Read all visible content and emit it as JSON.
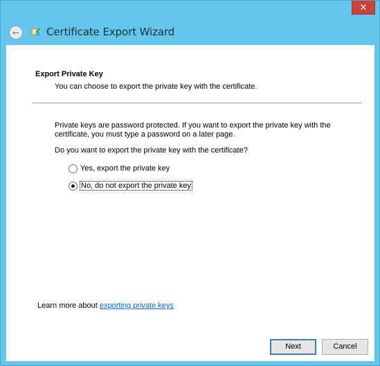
{
  "window": {
    "title": "Certificate Export Wizard",
    "close_glyph": "✕",
    "back_glyph": "⭠"
  },
  "page": {
    "heading": "Export Private Key",
    "subheading": "You can choose to export the private key with the certificate.",
    "paragraph": "Private keys are password protected. If you want to export the private key with the certificate, you must type a password on a later page.",
    "question": "Do you want to export the private key with the certificate?",
    "options": [
      {
        "label": "Yes, export the private key",
        "checked": false
      },
      {
        "label": "No, do not export the private key",
        "checked": true
      }
    ],
    "learn_more_prefix": "Learn more about ",
    "learn_more_link": "exporting private keys"
  },
  "buttons": {
    "next": "Next",
    "cancel": "Cancel"
  },
  "colors": {
    "frame": "#64c6ea",
    "close": "#c7443c",
    "link": "#0066cc"
  }
}
